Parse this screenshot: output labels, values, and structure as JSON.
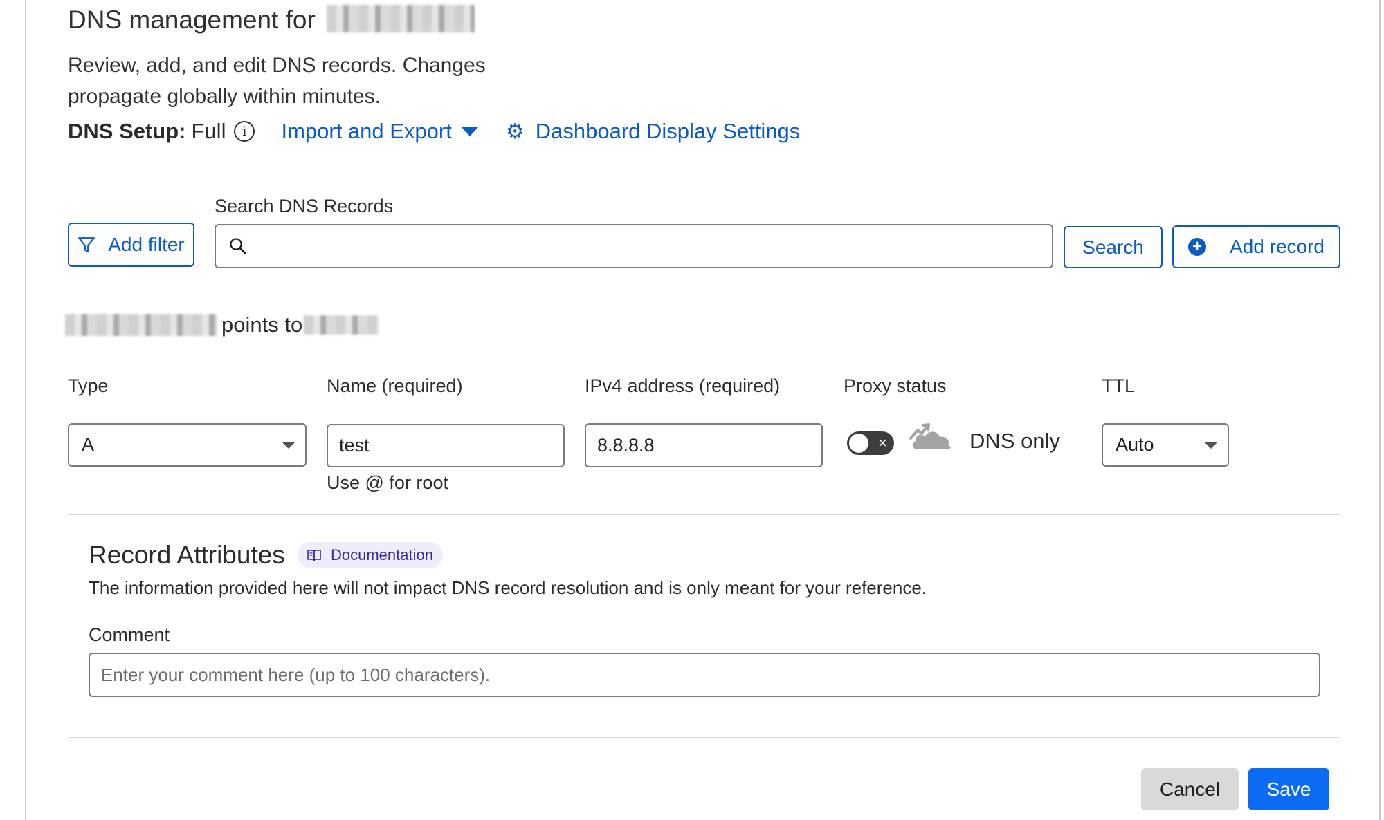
{
  "header": {
    "title_prefix": "DNS management for",
    "description": "Review, add, and edit DNS records. Changes propagate globally within minutes.",
    "setup_key": "DNS Setup:",
    "setup_value": "Full",
    "import_export_label": "Import and Export",
    "dashboard_settings_label": "Dashboard Display Settings"
  },
  "search": {
    "add_filter_label": "Add filter",
    "search_label": "Search DNS Records",
    "search_value": "",
    "search_button_label": "Search",
    "add_record_label": "Add record"
  },
  "record_preview": {
    "points_to_text": "points to"
  },
  "record_form": {
    "type_label": "Type",
    "type_value": "A",
    "name_label": "Name (required)",
    "name_value": "test",
    "name_help": "Use @ for root",
    "ipv4_label": "IPv4 address (required)",
    "ipv4_value": "8.8.8.8",
    "proxy_label": "Proxy status",
    "proxy_value": "DNS only",
    "ttl_label": "TTL",
    "ttl_value": "Auto"
  },
  "attributes": {
    "title": "Record Attributes",
    "documentation_label": "Documentation",
    "description": "The information provided here will not impact DNS record resolution and is only meant for your reference.",
    "comment_label": "Comment",
    "comment_placeholder": "Enter your comment here (up to 100 characters).",
    "comment_value": ""
  },
  "actions": {
    "cancel_label": "Cancel",
    "save_label": "Save"
  },
  "icons": {
    "info": "info-icon",
    "caret": "caret-down-icon",
    "settings": "gear-icon",
    "filter": "filter-icon",
    "search": "search-icon",
    "add": "plus-circle-icon",
    "proxy": "cloud-icon",
    "documentation": "book-icon"
  },
  "colors": {
    "link": "#0b5ac6",
    "primary_button": "#0b6bf2",
    "badge_bg": "#eeedfb",
    "badge_text": "#3b2a9a"
  }
}
